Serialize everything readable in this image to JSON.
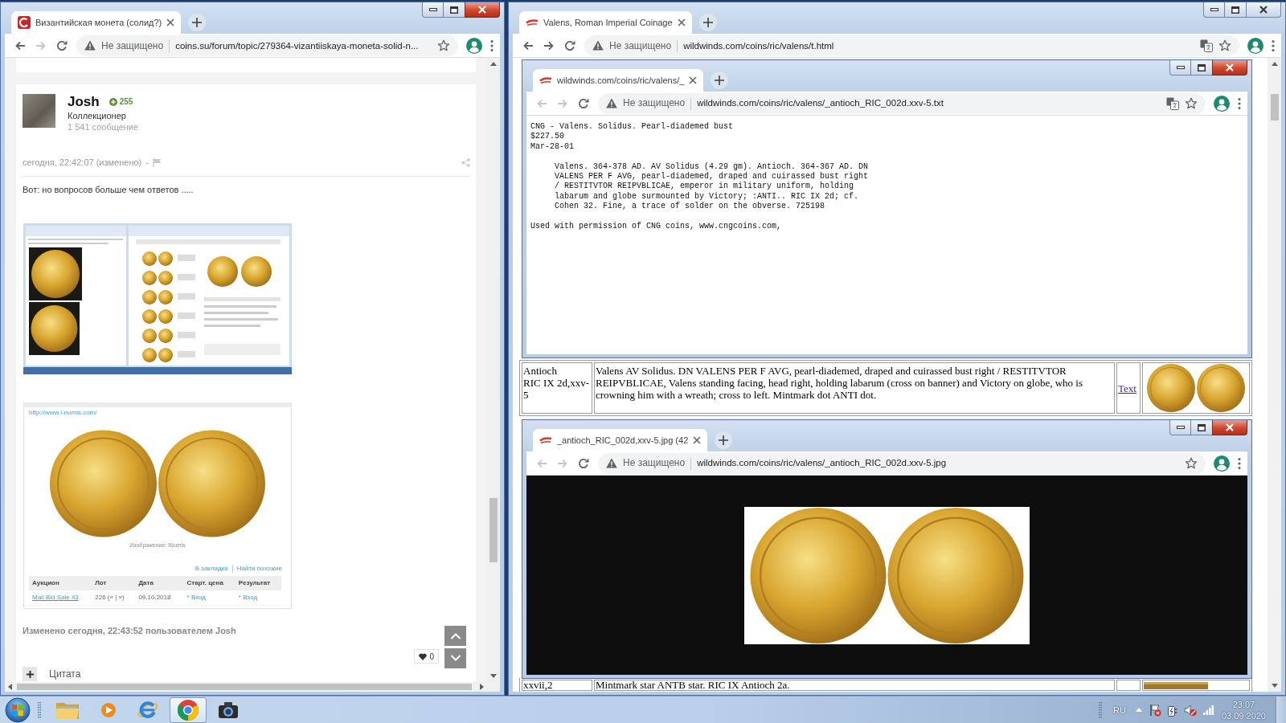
{
  "left_window": {
    "active": true,
    "tab": {
      "title": "Византийская монета (солид?)"
    },
    "toolbar": {
      "back": {
        "disabled": false
      },
      "forward": {
        "disabled": true
      },
      "security": "Не защищено",
      "url": "coins.su/forum/topic/279364-vizantiiskaya-moneta-solid-n..."
    },
    "post": {
      "author": "Josh",
      "reputation": "255",
      "rank": "Коллекционер",
      "post_count": "1 541 сообщение",
      "timestamp": "сегодня, 22:42:07 (изменено)",
      "separator": "-",
      "body": "Вот: но вопросов больше чем ответов .....",
      "catalog_card": {
        "source_link": "http://www.i-numis.com/",
        "caption": "Изображение: iNumis",
        "links": [
          "В закладки",
          "Найти похожие"
        ],
        "table": {
          "columns": [
            "Аукцион",
            "Лот",
            "Дата",
            "Старт. цена",
            "Результат"
          ],
          "rows": [
            {
              "cells": [
                {
                  "kind": "link",
                  "text": "Mail Bid Sale 43"
                },
                {
                  "kind": "text",
                  "text": "226 (« | »)"
                },
                {
                  "kind": "text",
                  "text": "09.10.2018"
                },
                {
                  "kind": "action",
                  "text": "* Вход"
                },
                {
                  "kind": "action",
                  "text": "* Вход"
                }
              ]
            }
          ]
        }
      },
      "edit_note": "Изменено сегодня, 22:43:52 пользователем Josh",
      "like_count": "0",
      "quote_label": "Цитата"
    }
  },
  "right_window": {
    "active": false,
    "tab": {
      "title": "Valens, Roman Imperial Coinage"
    },
    "toolbar": {
      "back": {
        "disabled": false
      },
      "forward": {
        "disabled": false
      },
      "security": "Не защищено",
      "url": "wildwinds.com/coins/ric/valens/t.html",
      "translate": true
    },
    "table": {
      "rows": [
        {
          "cells": [
            {
              "kind": "text",
              "lines": [
                "Antioch",
                "RIC IX 2d,xxv-5"
              ]
            },
            {
              "kind": "text",
              "lines": [
                "Valens AV Solidus. DN VALENS PER F AVG, pearl-diademed, draped and cuirassed bust right / RESTITVTOR REIPVBLICAE, Valens standing facing, head right, holding labarum (cross on banner) and Victory on globe, who is crowning him with a wreath; cross to left. Mintmark dot ANTI dot."
              ]
            },
            {
              "kind": "link",
              "text": "Text"
            },
            {
              "kind": "image"
            }
          ]
        },
        {
          "cells": [
            {
              "kind": "text",
              "lines": [
                "xxvii,2"
              ]
            },
            {
              "kind": "text",
              "lines": [
                "Mintmark star ANTB star. RIC IX Antioch 2a."
              ]
            },
            {
              "kind": "blank"
            },
            {
              "kind": "image"
            }
          ]
        }
      ]
    },
    "popups": [
      {
        "kind": "text",
        "active": true,
        "tab": {
          "title": "wildwinds.com/coins/ric/valens/_"
        },
        "toolbar": {
          "back": {
            "disabled": true
          },
          "forward": {
            "disabled": true
          },
          "security": "Не защищено",
          "url": "wildwinds.com/coins/ric/valens/_antioch_RIC_002d.xxv-5.txt",
          "translate": true
        },
        "document": [
          {
            "indented": false,
            "lines": [
              "CNG - Valens. Solidus. Pearl-diademed bust",
              "$227.50",
              "Mar-28-01"
            ]
          },
          {
            "indented": true,
            "lines": [
              "Valens. 364-378 AD. AV Solidus (4.29 gm). Antioch. 364-367 AD. DN",
              "VALENS PER F AVG, pearl-diademed, draped and cuirassed bust right",
              "/ RESTITVTOR REIPVBLICAE, emperor in military uniform, holding",
              "labarum and globe surmounted by Victory; :ANTI.. RIC IX 2d; cf.",
              "Cohen 32. Fine, a trace of solder on the obverse. 725198"
            ]
          },
          {
            "indented": false,
            "lines": [
              "Used with permission of CNG coins, www.cngcoins.com,"
            ]
          }
        ]
      },
      {
        "kind": "image",
        "active": true,
        "tab": {
          "title": "_antioch_RIC_002d,xxv-5.jpg (42"
        },
        "toolbar": {
          "back": {
            "disabled": true
          },
          "forward": {
            "disabled": true
          },
          "security": "Не защищено",
          "url": "wildwinds.com/coins/ric/valens/_antioch_RIC_002d.xxv-5.jpg"
        }
      }
    ]
  },
  "taskbar": {
    "apps": [
      {
        "kind": "explorer",
        "selected": false
      },
      {
        "kind": "media",
        "selected": false
      },
      {
        "kind": "browser_e",
        "selected": false
      },
      {
        "kind": "browser_ring",
        "selected": true
      },
      {
        "kind": "camera",
        "selected": false
      }
    ],
    "tray": {
      "language": "RU",
      "time": "23:07",
      "date": "03.09.2020"
    }
  }
}
